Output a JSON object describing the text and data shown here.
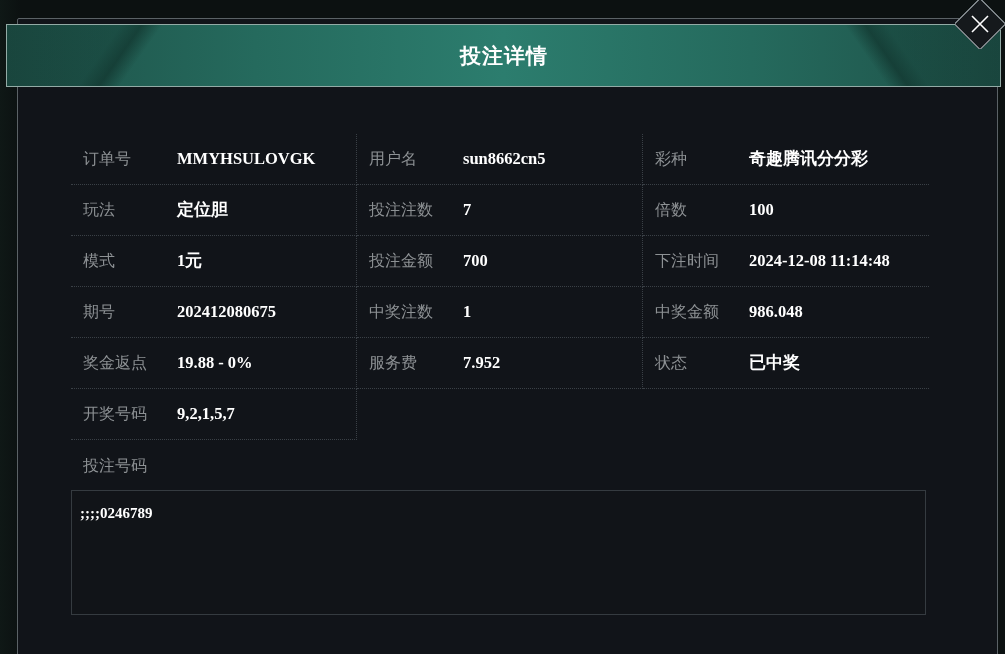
{
  "dialog": {
    "title": "投注详情"
  },
  "fields": [
    {
      "label": "订单号",
      "value": "MMYHSULOVGK"
    },
    {
      "label": "用户名",
      "value": "sun8662cn5"
    },
    {
      "label": "彩种",
      "value": "奇趣腾讯分分彩"
    },
    {
      "label": "玩法",
      "value": "定位胆"
    },
    {
      "label": "投注注数",
      "value": "7"
    },
    {
      "label": "倍数",
      "value": "100"
    },
    {
      "label": "模式",
      "value": "1元"
    },
    {
      "label": "投注金额",
      "value": "700"
    },
    {
      "label": "下注时间",
      "value": "2024-12-08 11:14:48"
    },
    {
      "label": "期号",
      "value": "202412080675"
    },
    {
      "label": "中奖注数",
      "value": "1"
    },
    {
      "label": "中奖金额",
      "value": "986.048"
    },
    {
      "label": "奖金返点",
      "value": "19.88 - 0%"
    },
    {
      "label": "服务费",
      "value": "7.952"
    },
    {
      "label": "状态",
      "value": "已中奖"
    },
    {
      "label": "开奖号码",
      "value": "9,2,1,5,7"
    }
  ],
  "bet_numbers": {
    "label": "投注号码",
    "value": ";;;;0246789"
  }
}
